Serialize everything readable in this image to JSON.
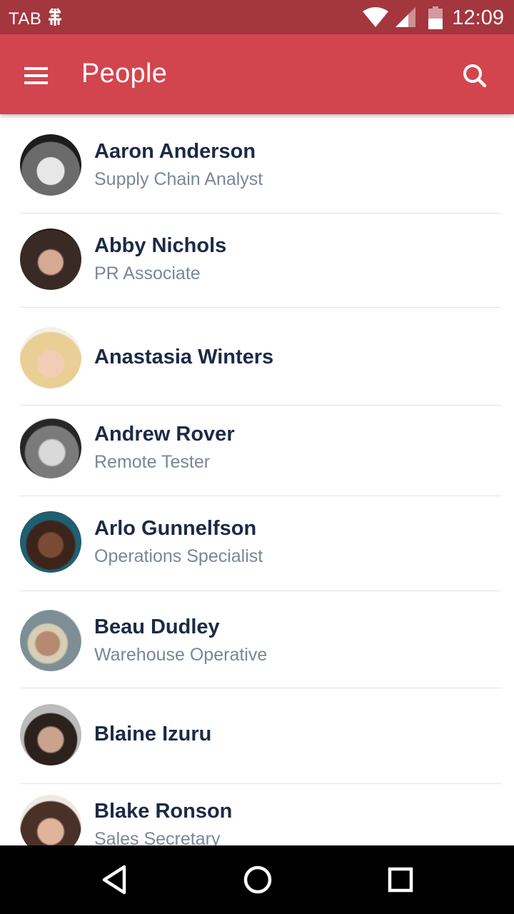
{
  "status_bar": {
    "carrier": "TAB",
    "time": "12:09",
    "icons": [
      "carrier-network-icon",
      "wifi-icon",
      "signal-icon",
      "battery-icon"
    ]
  },
  "app_bar": {
    "title": "People",
    "menu_icon": "hamburger-menu-icon",
    "search_icon": "search-icon"
  },
  "people": [
    {
      "name": "Aaron Anderson",
      "role": "Supply Chain Analyst"
    },
    {
      "name": "Abby Nichols",
      "role": "PR Associate"
    },
    {
      "name": "Anastasia Winters",
      "role": ""
    },
    {
      "name": "Andrew Rover",
      "role": "Remote Tester"
    },
    {
      "name": "Arlo Gunnelfson",
      "role": "Operations Specialist"
    },
    {
      "name": "Beau Dudley",
      "role": "Warehouse Operative"
    },
    {
      "name": "Blaine Izuru",
      "role": ""
    },
    {
      "name": "Blake Ronson",
      "role": "Sales Secretary"
    }
  ],
  "nav_bar": {
    "buttons": [
      "back-icon",
      "home-icon",
      "recents-icon"
    ]
  },
  "colors": {
    "status_bar": "#a4363e",
    "app_bar": "#d2454f",
    "name_text": "#1c2a47",
    "role_text": "#7b8698",
    "divider": "#e1e3e8"
  }
}
